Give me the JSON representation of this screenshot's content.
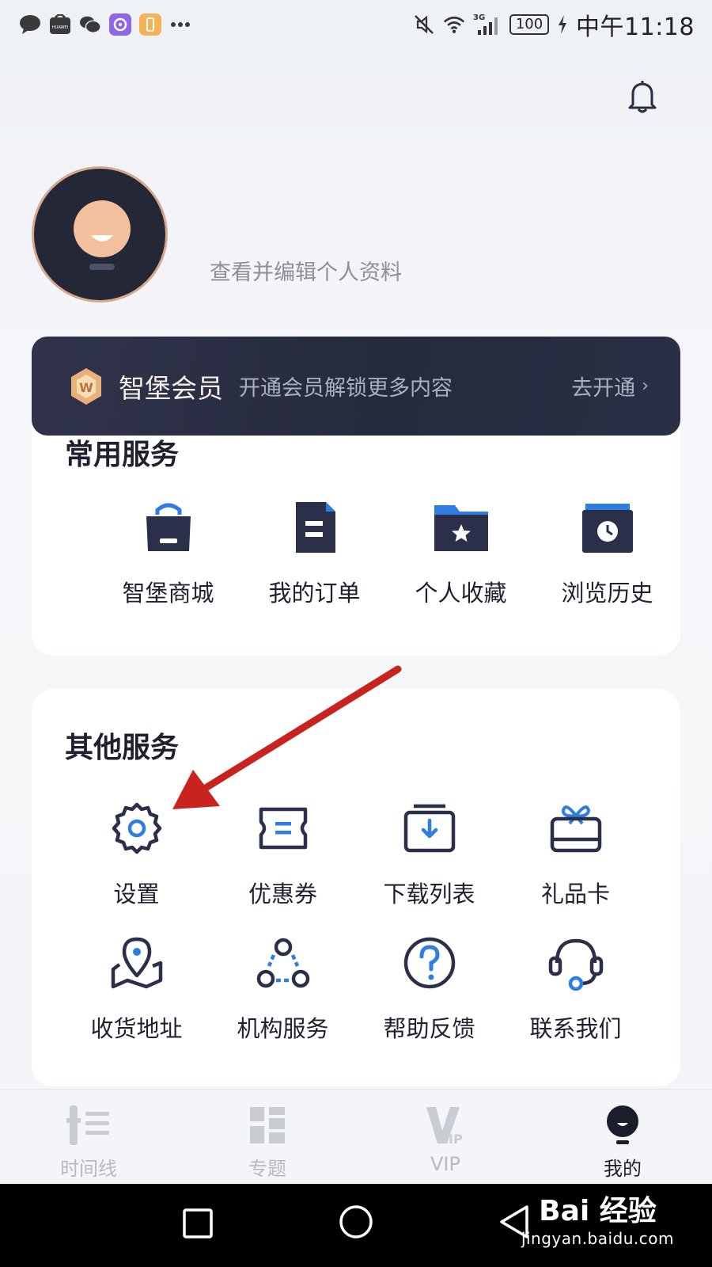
{
  "status_bar": {
    "time": "中午11:18",
    "battery": "100",
    "network": "3G"
  },
  "profile": {
    "edit_link": "查看并编辑个人资料"
  },
  "vip_banner": {
    "title": "智堡会员",
    "description": "开通会员解锁更多内容",
    "cta": "去开通",
    "cta_arrow": "›"
  },
  "common_services": {
    "title": "常用服务",
    "items": [
      {
        "label": "智堡商城",
        "icon": "shopping-bag-icon"
      },
      {
        "label": "我的订单",
        "icon": "order-document-icon"
      },
      {
        "label": "个人收藏",
        "icon": "favorites-folder-icon"
      },
      {
        "label": "浏览历史",
        "icon": "history-clock-icon"
      }
    ]
  },
  "other_services": {
    "title": "其他服务",
    "items": [
      {
        "label": "设置",
        "icon": "gear-icon"
      },
      {
        "label": "优惠券",
        "icon": "coupon-icon"
      },
      {
        "label": "下载列表",
        "icon": "download-icon"
      },
      {
        "label": "礼品卡",
        "icon": "gift-card-icon"
      },
      {
        "label": "收货地址",
        "icon": "location-pin-icon"
      },
      {
        "label": "机构服务",
        "icon": "organization-icon"
      },
      {
        "label": "帮助反馈",
        "icon": "help-question-icon"
      },
      {
        "label": "联系我们",
        "icon": "headset-icon"
      }
    ]
  },
  "tab_bar": {
    "tabs": [
      {
        "label": "时间线",
        "active": false
      },
      {
        "label": "专题",
        "active": false
      },
      {
        "label": "VIP",
        "active": false
      },
      {
        "label": "我的",
        "active": true
      }
    ]
  },
  "watermark": {
    "logo": "Bai 经验",
    "url": "jingyan.baidu.com"
  },
  "colors": {
    "accent_blue": "#2f7de1",
    "dark_navy": "#2b2f4a",
    "annotation_red": "#c8231f"
  }
}
